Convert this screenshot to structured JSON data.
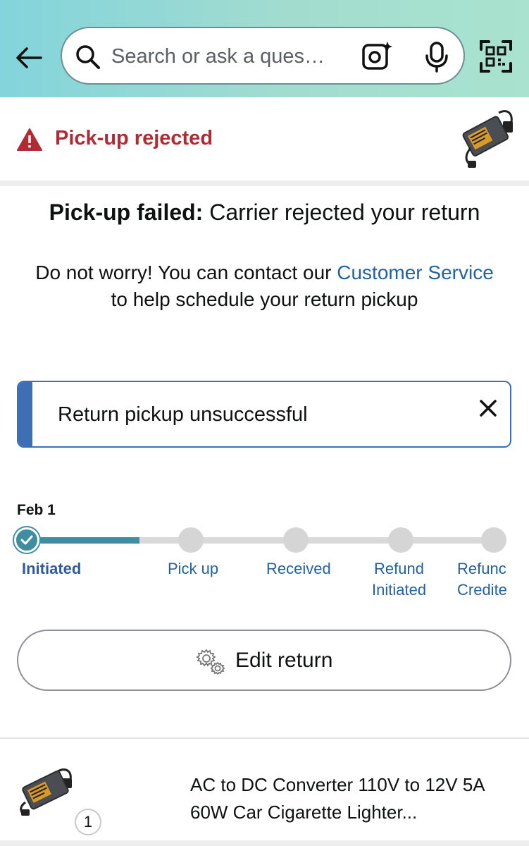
{
  "header": {
    "search_placeholder": "Search or ask a ques…",
    "back_icon": "back-arrow-icon",
    "camera_icon": "camera-lens-icon",
    "mic_icon": "microphone-icon",
    "qr_icon": "qr-scan-icon"
  },
  "status": {
    "label": "Pick-up rejected",
    "color": "#b12b35"
  },
  "message": {
    "title_bold": "Pick-up failed:",
    "title_rest": " Carrier rejected your return",
    "body_pre": "Do not worry! You can contact our ",
    "body_link": "Customer Service",
    "body_post": " to help schedule your return pickup"
  },
  "alert": {
    "text": "Return pickup unsuccessful",
    "accent_color": "#3e6fb4"
  },
  "tracker": {
    "date": "Feb 1",
    "progress_color": "#3f8ea0",
    "steps": [
      {
        "label": "Initiated",
        "state": "done"
      },
      {
        "label": "Pick up",
        "state": "pending"
      },
      {
        "label": "Received",
        "state": "pending"
      },
      {
        "label": "Refund",
        "label2": "Initiated",
        "state": "pending"
      },
      {
        "label": "Refunc",
        "label2": "Credite",
        "state": "pending"
      }
    ]
  },
  "edit_button": {
    "label": "Edit return"
  },
  "item": {
    "title_line1": "AC to DC Converter 110V to 12V 5A",
    "title_line2": "60W Car Cigarette Lighter...",
    "quantity": "1"
  }
}
